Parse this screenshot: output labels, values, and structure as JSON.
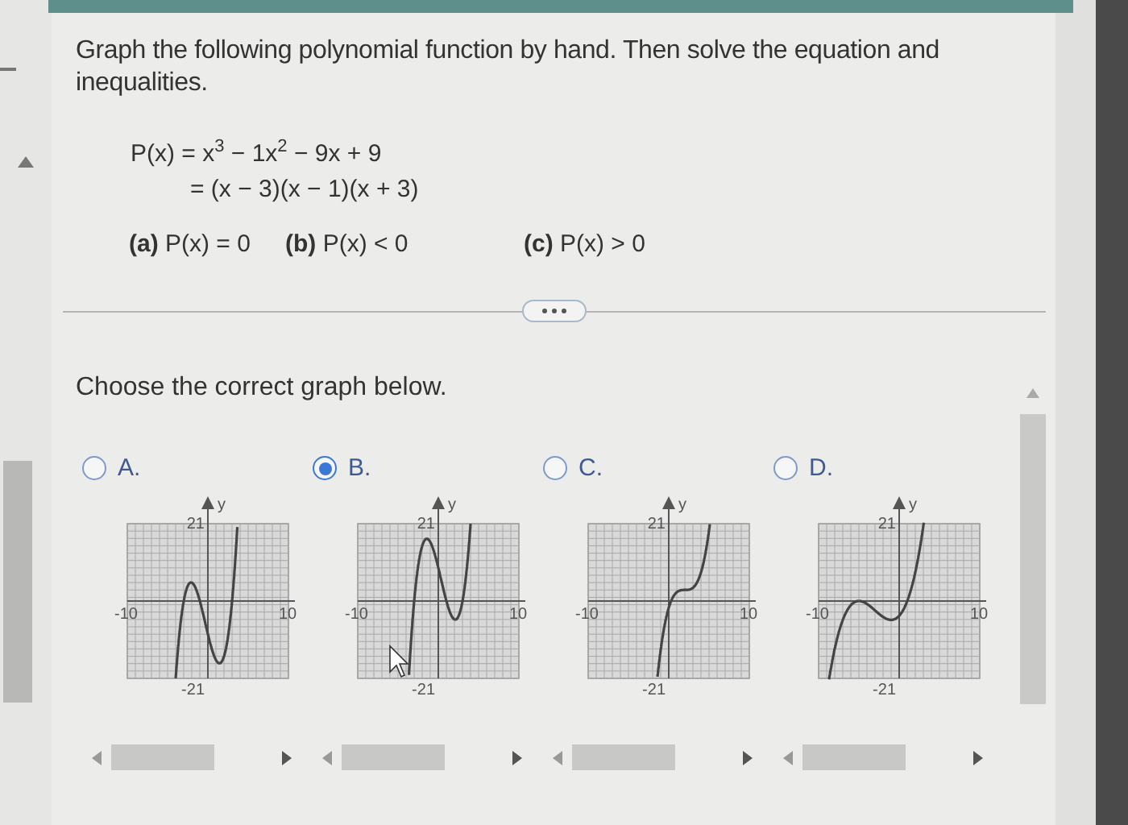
{
  "question": {
    "instruction": "Graph the following polynomial function by hand. Then solve the equation and inequalities.",
    "equation_lines": [
      "P(x) = x$^{3}$ − 1x$^{2}$ − 9x + 9",
      "= (x − 3)(x − 1)(x + 3)"
    ],
    "parts": [
      {
        "label": "(a)",
        "text": "P(x) = 0"
      },
      {
        "label": "(b)",
        "text": "P(x) < 0"
      },
      {
        "label": "(c)",
        "text": "P(x) > 0"
      }
    ]
  },
  "prompt": "Choose the correct graph below.",
  "options": [
    {
      "label": "A.",
      "selected": false,
      "kind": "a",
      "axis_y": "y",
      "x_min": "-10",
      "x_max": "10",
      "y_max": "21",
      "y_min": "-21"
    },
    {
      "label": "B.",
      "selected": true,
      "kind": "b",
      "axis_y": "y",
      "x_min": "-10",
      "x_max": "10",
      "y_max": "21",
      "y_min": "-21"
    },
    {
      "label": "C.",
      "selected": false,
      "kind": "c",
      "axis_y": "y",
      "x_min": "-10",
      "x_max": "10",
      "y_max": "21",
      "y_min": "-21"
    },
    {
      "label": "D.",
      "selected": false,
      "kind": "d",
      "axis_y": "y",
      "x_min": "-10",
      "x_max": "10",
      "y_max": "21",
      "y_min": "-21"
    }
  ]
}
